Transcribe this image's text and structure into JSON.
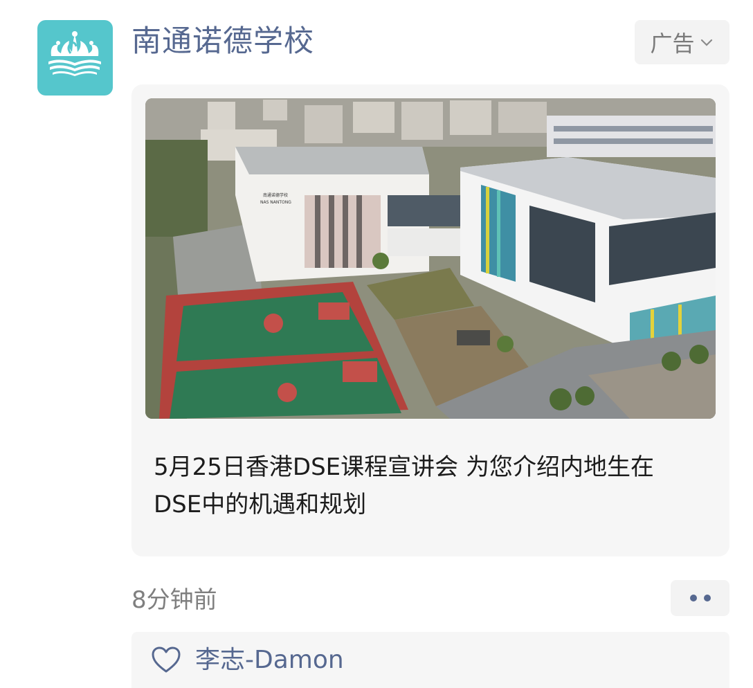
{
  "post": {
    "author_name": "南通诺德学校",
    "ad_label": "广告",
    "caption_line1": "5月25日香港DSE课程宣讲会 为您介绍内地生在",
    "caption_line2": "DSE中的机遇和规划",
    "timestamp": "8分钟前"
  },
  "photo": {
    "building_sign_cn": "南通诺德学校",
    "building_sign_en": "NAS NANTONG"
  },
  "likes": {
    "names": "李志-Damon"
  },
  "icons": {
    "avatar_logo": "crown-book-logo",
    "ad_menu": "chevron-down-icon",
    "more": "more-dots-icon",
    "like": "heart-icon"
  },
  "colors": {
    "link_blue": "#566890",
    "avatar_teal": "#55c6cc",
    "card_bg": "#f6f6f6"
  }
}
